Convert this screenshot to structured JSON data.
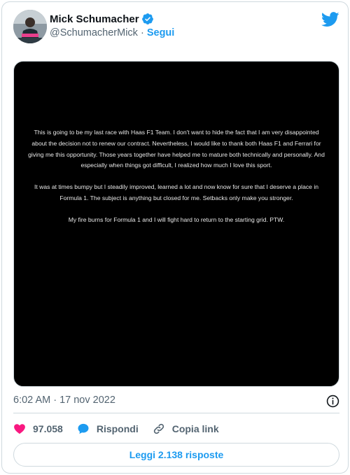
{
  "author": {
    "name": "Mick Schumacher",
    "handle": "@SchumacherMick",
    "separator": "·",
    "follow_label": "Segui",
    "verified": true
  },
  "media": {
    "paragraphs": [
      "This is going to be my last race with Haas F1 Team. I don't want to hide the fact that I am very disappointed about the decision not to renew our contract. Nevertheless, I would like to thank both Haas F1 and Ferrari for giving me this opportunity. Those years together have helped me to mature both technically and personally. And especially when things got difficult, I realized how much I love this sport.",
      "It was at times bumpy but I steadily improved, learned a lot and now know for sure that I deserve a place in Formula 1. The subject is anything but closed for me. Setbacks only make you stronger.",
      "My fire burns for Formula 1 and I will fight hard to return to the starting grid. PTW."
    ]
  },
  "timestamp": "6:02 AM · 17 nov 2022",
  "actions": {
    "likes": "97.058",
    "reply_label": "Rispondi",
    "copy_link_label": "Copia link"
  },
  "read_replies_label": "Leggi 2.138 risposte",
  "colors": {
    "accent": "#1d9bf0",
    "like": "#f91880",
    "muted": "#536471"
  }
}
